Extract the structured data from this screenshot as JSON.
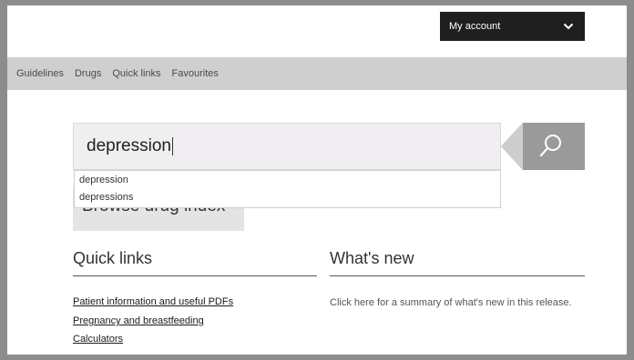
{
  "header": {
    "account_label": "My account"
  },
  "nav": {
    "items": [
      "Guidelines",
      "Drugs",
      "Quick links",
      "Favourites"
    ]
  },
  "search": {
    "value": "depression",
    "button_icon": "search-icon"
  },
  "suggestions": [
    "depression",
    "depressions"
  ],
  "browse": {
    "label": "Browse drug index"
  },
  "quick_links": {
    "title": "Quick links",
    "links": [
      "Patient information and useful PDFs",
      "Pregnancy and breastfeeding",
      "Calculators"
    ]
  },
  "whats_new": {
    "title": "What's new",
    "text": "Click here for a summary of what's new in this release."
  },
  "colors": {
    "account_bg": "#1f1f1f",
    "nav_bg": "#cfcfcf",
    "search_btn_dark": "#9a9a9a",
    "search_btn_light": "#cdcdcd"
  }
}
